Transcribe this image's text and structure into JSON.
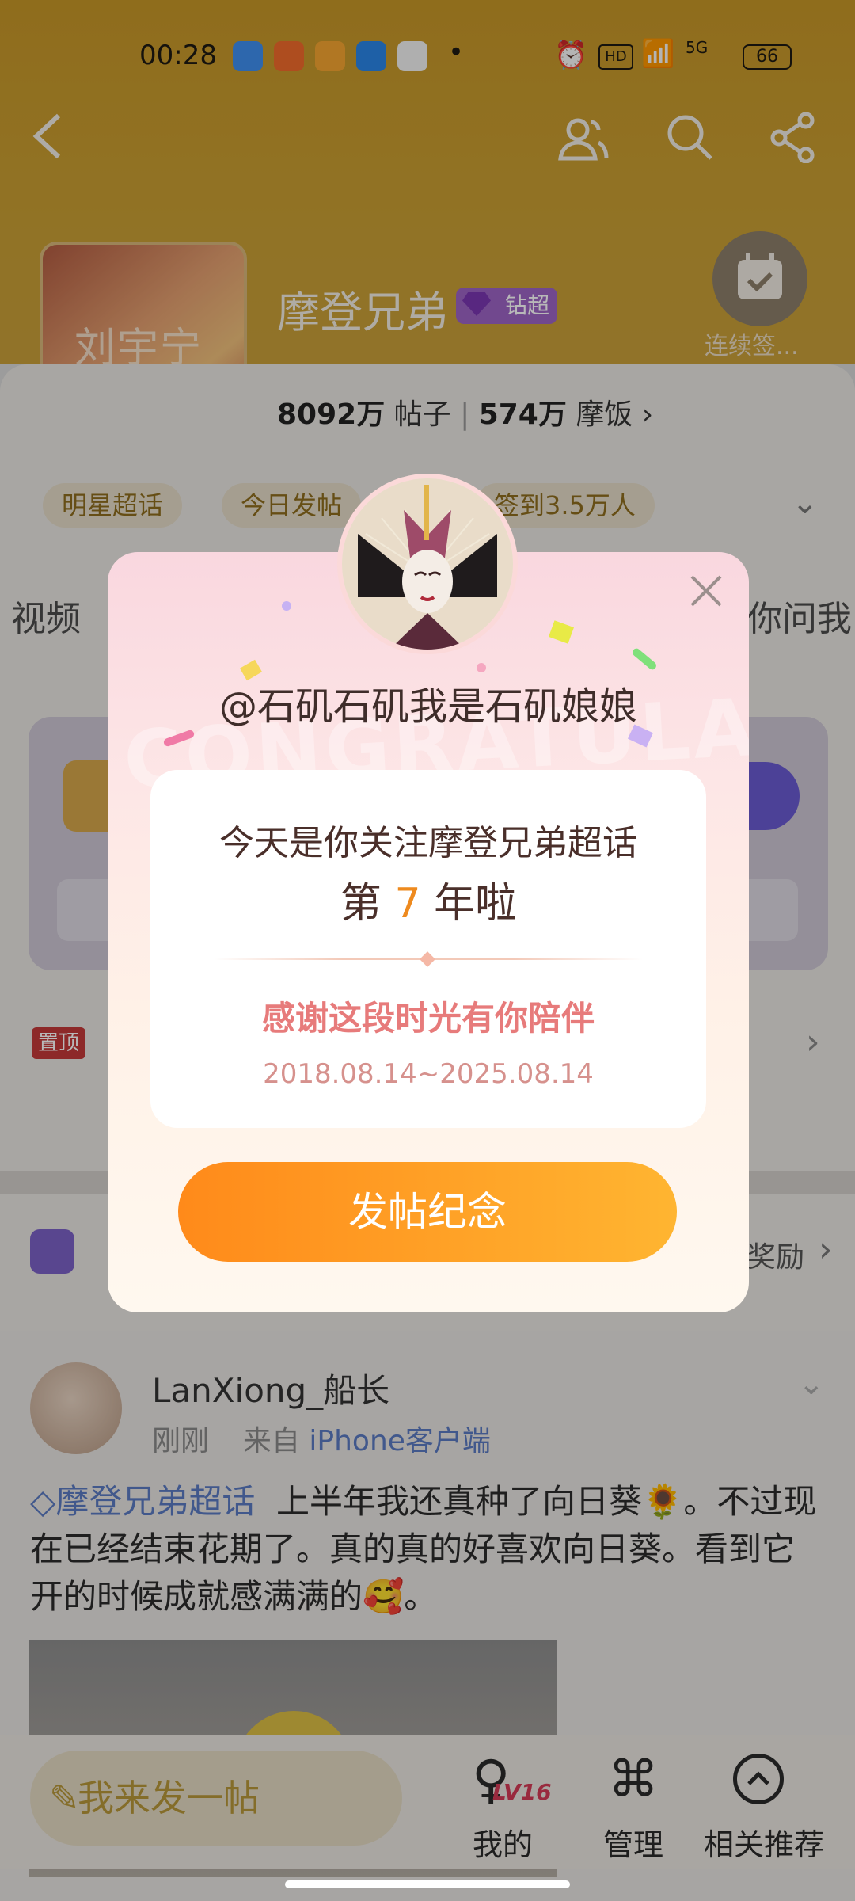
{
  "status_bar": {
    "time": "00:28",
    "extra": "HD",
    "network": "5G",
    "battery": "66"
  },
  "header": {
    "back_icon": "back-arrow-icon",
    "right_icons": [
      "members-icon",
      "search-icon",
      "share-icon"
    ],
    "cover_text": "刘宇宁",
    "title": "摩登兄弟",
    "badge_label": "钻超",
    "checkin_label": "连续签...",
    "stats": {
      "posts_value": "8092万",
      "posts_label": "帖子",
      "fans_value": "574万",
      "fans_label": "摩饭"
    }
  },
  "tags": {
    "t1": "明星超话",
    "t2": "今日发帖",
    "t3": "签到3.5万人"
  },
  "tabs": {
    "left": "视频",
    "right": "你问我"
  },
  "pinned": {
    "label": "置顶"
  },
  "post_entry": {
    "right_text": "奖励"
  },
  "post": {
    "username": "LanXiong_船长",
    "time": "刚刚",
    "source_prefix": "来自",
    "source": "iPhone客户端",
    "topic": "摩登兄弟超话",
    "content": "上半年我还真种了向日葵🌻。不过现在已经结束花期了。真的真的好喜欢向日葵。看到它开的时候成就感满满的🥰。"
  },
  "bottom_bar": {
    "compose_placeholder": "我来发一帖",
    "level_badge": "LV16",
    "mine": "我的",
    "manage": "管理",
    "related": "相关推荐"
  },
  "modal": {
    "watermark": "CONGRATULATE",
    "handle": "@石矶石矶我是石矶娘娘",
    "line1": "今天是你关注摩登兄弟超话",
    "line2_prefix": "第",
    "years": "7",
    "line2_suffix": "年啦",
    "thanks": "感谢这段时光有你陪伴",
    "date_range": "2018.08.14~2025.08.14",
    "cta": "发帖纪念",
    "close_icon": "close-icon"
  },
  "colors": {
    "accent": "#ff9a22",
    "header": "#c9a030",
    "topic": "#5b7bc2"
  }
}
